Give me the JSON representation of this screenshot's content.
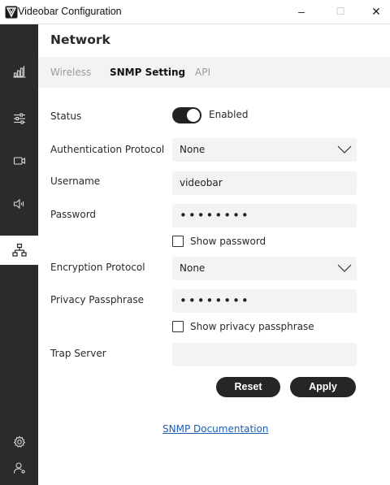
{
  "window": {
    "title": "Videobar Configuration",
    "minimize_glyph": "–",
    "maximize_glyph": "☐",
    "close_glyph": "✕"
  },
  "sidebar": {
    "items": [
      {
        "icon": "signal-bars-icon"
      },
      {
        "icon": "sliders-icon"
      },
      {
        "icon": "camera-icon"
      },
      {
        "icon": "speaker-icon"
      },
      {
        "icon": "network-icon",
        "active": true
      },
      {
        "icon": "gear-icon"
      },
      {
        "icon": "user-icon"
      }
    ]
  },
  "header": {
    "title": "Network",
    "tabs": [
      {
        "label": "Wireless"
      },
      {
        "label": "SNMP Setting",
        "active": true
      },
      {
        "label": "API"
      }
    ]
  },
  "form": {
    "status": {
      "label": "Status",
      "value": "Enabled",
      "enabled": true
    },
    "auth_protocol": {
      "label": "Authentication Protocol",
      "value": "None"
    },
    "username": {
      "label": "Username",
      "value": "videobar"
    },
    "password": {
      "label": "Password",
      "value": "••••••••"
    },
    "show_password": {
      "label": "Show password",
      "checked": false
    },
    "encryption_protocol": {
      "label": "Encryption Protocol",
      "value": "None"
    },
    "privacy_passphrase": {
      "label": "Privacy Passphrase",
      "value": "••••••••"
    },
    "show_privacy_passphrase": {
      "label": "Show privacy passphrase",
      "checked": false
    },
    "trap_server": {
      "label": "Trap Server",
      "value": ""
    }
  },
  "actions": {
    "reset_label": "Reset",
    "apply_label": "Apply"
  },
  "footer": {
    "doc_link": "SNMP Documentation"
  },
  "colors": {
    "sidebar_bg": "#2b2b2b",
    "field_bg": "#f3f3f3",
    "button_bg": "#262626",
    "link": "#1a5fb4"
  }
}
